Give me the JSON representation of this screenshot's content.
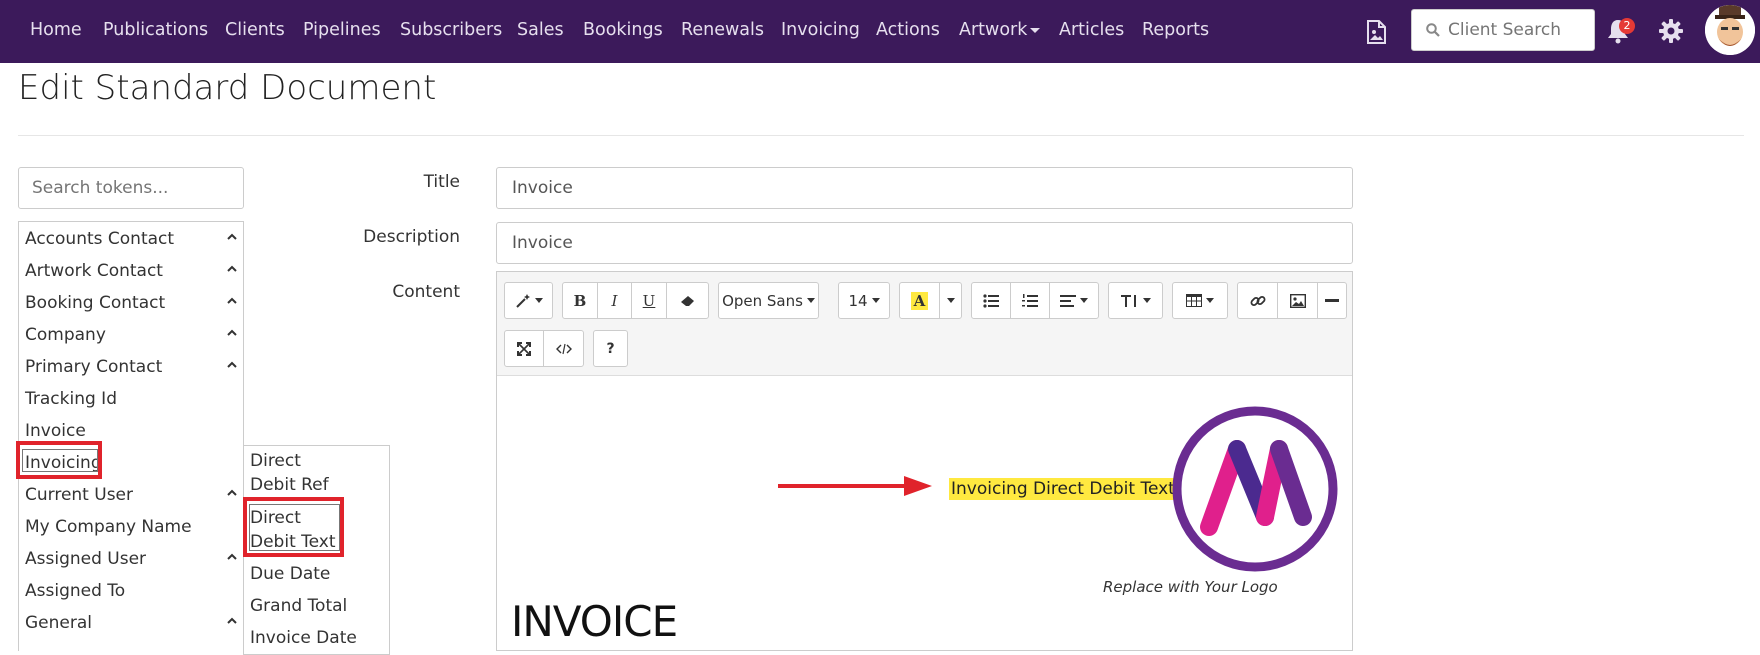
{
  "nav": {
    "items": [
      "Home",
      "Publications",
      "Clients",
      "Pipelines",
      "Subscribers",
      "Sales",
      "Bookings",
      "Renewals",
      "Invoicing",
      "Actions",
      "Artwork",
      "Articles",
      "Reports"
    ],
    "client_search_placeholder": "Client Search",
    "notification_count": "2"
  },
  "page": {
    "title": "Edit Standard Document"
  },
  "tokens": {
    "search_placeholder": "Search tokens...",
    "items": [
      "Accounts Contact",
      "Artwork Contact",
      "Booking Contact",
      "Company",
      "Primary Contact",
      "Tracking Id",
      "Invoice",
      "Invoicing",
      "Current User",
      "My Company Name",
      "Assigned User",
      "Assigned To",
      "General"
    ],
    "submenu": [
      "Direct Debit Ref",
      "Direct Debit Text",
      "Due Date",
      "Grand Total",
      "Invoice Date"
    ]
  },
  "form": {
    "title_label": "Title",
    "title_value": "Invoice",
    "description_label": "Description",
    "description_value": "Invoice",
    "content_label": "Content"
  },
  "editor": {
    "font_name": "Open Sans",
    "font_size": "14",
    "highlighted_token": "Invoicing Direct Debit Text",
    "logo_caption": "Replace with Your Logo",
    "heading": "INVOICE"
  },
  "colors": {
    "navbar": "#3c1a5b",
    "annotation_red": "#e0232b",
    "highlight": "#ffe940",
    "logo_ring": "#6a2c91",
    "logo_magenta": "#e0208c"
  }
}
